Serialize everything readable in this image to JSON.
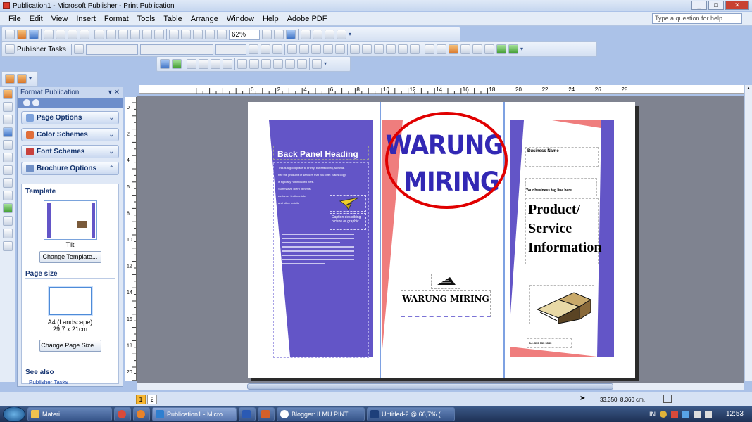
{
  "window": {
    "title": "Publication1 - Microsoft Publisher - Print Publication"
  },
  "menu": {
    "items": [
      "File",
      "Edit",
      "View",
      "Insert",
      "Format",
      "Tools",
      "Table",
      "Arrange",
      "Window",
      "Help",
      "Adobe PDF"
    ],
    "help_placeholder": "Type a question for help"
  },
  "toolbar": {
    "zoom": "62%",
    "publisher_tasks": "Publisher Tasks"
  },
  "taskpane": {
    "title": "Format Publication",
    "sections": [
      "Page Options",
      "Color Schemes",
      "Font Schemes",
      "Brochure Options"
    ],
    "template_label": "Template",
    "template_name": "Tilt",
    "change_template": "Change Template...",
    "page_size_label": "Page size",
    "page_size_name": "A4 (Landscape)",
    "page_size_dims": "29,7 x 21cm",
    "change_page_size": "Change Page Size...",
    "see_also": "See also",
    "see_also_link": "Publisher Tasks"
  },
  "ruler": {
    "h": [
      "0",
      "2",
      "4",
      "6",
      "8",
      "10",
      "12",
      "14",
      "16",
      "18",
      "20",
      "22",
      "24",
      "26",
      "28"
    ],
    "v": [
      "0",
      "2",
      "4",
      "6",
      "8",
      "10",
      "12",
      "14",
      "16",
      "18",
      "20"
    ]
  },
  "brochure": {
    "back_heading": "Back Panel Heading",
    "back_body": [
      "This is a good place to briefly, but effectively, summa-",
      "rize the products or services that you offer. Sales copy",
      "is typically not included here.",
      "Summarize client benefits,",
      "customer testimonials,",
      "and other details"
    ],
    "back_caption": "Caption describing picture or graphic.",
    "title_line1": "WARUNG",
    "title_line2": "MIRING",
    "org_name": "WARUNG MIRING",
    "business_name": "Business Name",
    "tagline": "Your business tag line here.",
    "product_title": "Product/ Service Information",
    "phone": "Tel: 555 555 5555"
  },
  "status": {
    "coords": "33,350; 8,360 cm.",
    "pages": [
      "1",
      "2"
    ]
  },
  "taskbar": {
    "start": "Start",
    "items": [
      "Materi",
      "Publication1 - Micro...",
      "Blogger: ILMU PINT...",
      "Untitled-2 @ 66,7% (..."
    ],
    "lang": "IN",
    "clock": "12:53"
  },
  "colors": {
    "purple": "#6355c7",
    "salmon": "#ef7d7d",
    "title_blue": "#3228b4",
    "ellipse": "#e00000"
  }
}
